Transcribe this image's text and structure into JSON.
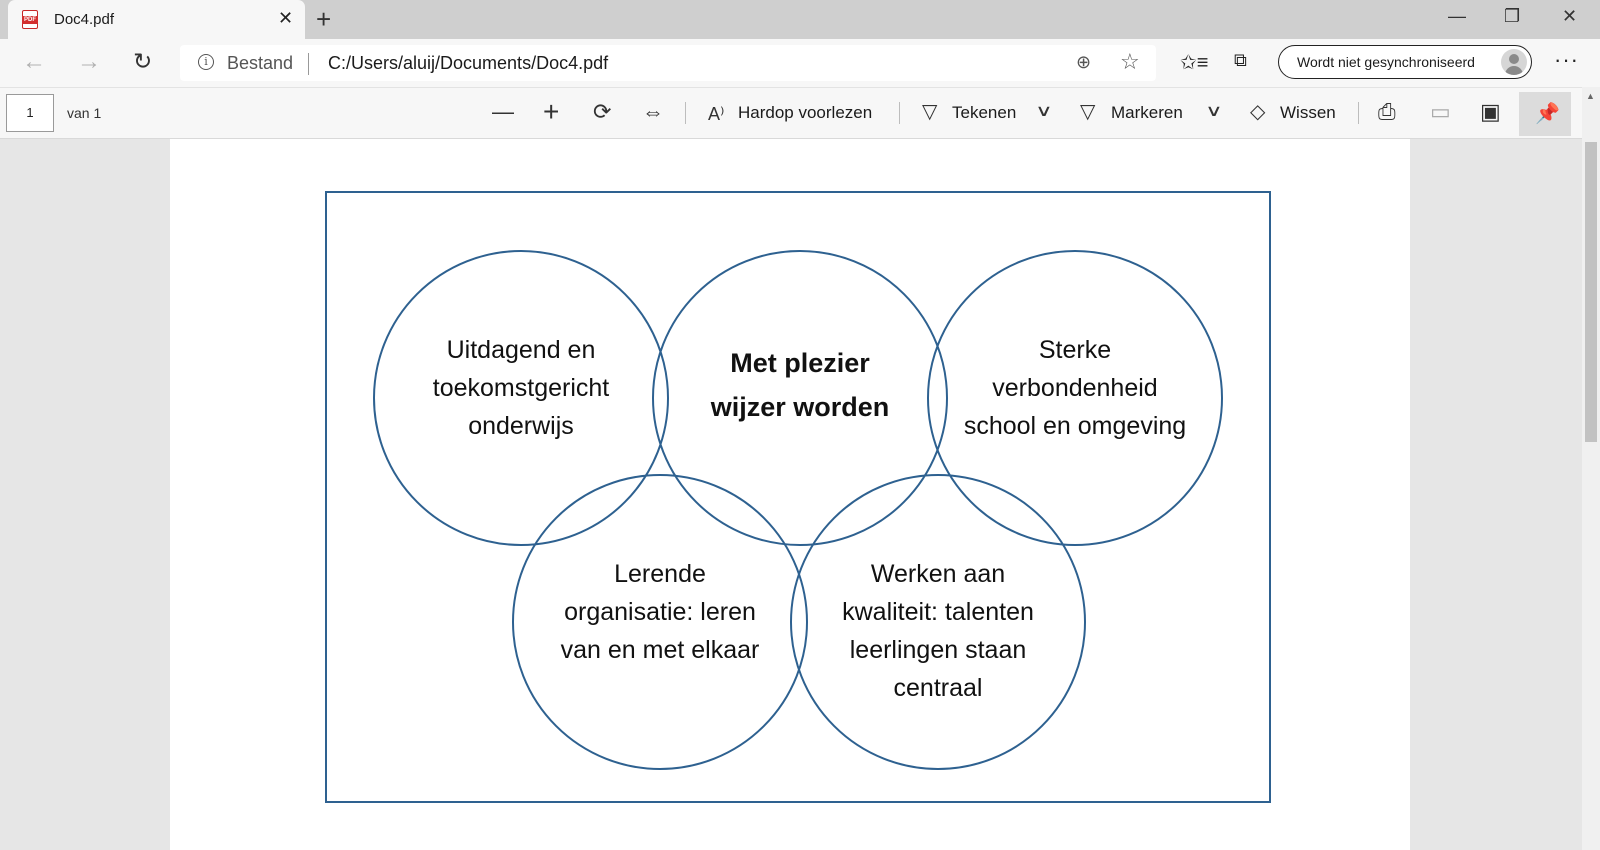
{
  "tab": {
    "title": "Doc4.pdf",
    "close": "✕",
    "new_tab": "+"
  },
  "window": {
    "minimize": "—",
    "restore": "❐",
    "close": "✕"
  },
  "nav": {
    "back": "←",
    "forward": "→",
    "refresh": "↻",
    "info": "i",
    "scheme": "Bestand",
    "url": "C:/Users/aluij/Documents/Doc4.pdf",
    "zoom": "⊕",
    "star": "☆",
    "favorites": "✩≡",
    "collections": "⧉",
    "sync_label": "Wordt niet gesynchroniseerd",
    "more": "···"
  },
  "pdf_toolbar": {
    "page_number": "1",
    "page_of": "van 1",
    "zoom_out": "—",
    "zoom_in": "+",
    "rotate": "⟳",
    "fit": "⇔",
    "read_aloud": "Hardop voorlezen",
    "read_icon": "A⁾",
    "draw": "Tekenen",
    "draw_icon": "▽",
    "highlight": "Markeren",
    "highlight_icon": "▽",
    "erase": "Wissen",
    "erase_icon": "◇",
    "chevron": "∨",
    "print": "⎙",
    "save": "▭",
    "save_as": "▣",
    "pin": "📌"
  },
  "diagram": {
    "stroke_color": "#2e6190",
    "circles": [
      {
        "lines": [
          "Uitdagend en",
          "toekomstgericht",
          "onderwijs"
        ],
        "bold": false
      },
      {
        "lines": [
          "Met plezier",
          "wijzer worden"
        ],
        "bold": true
      },
      {
        "lines": [
          "Sterke",
          "verbondenheid",
          "school en omgeving"
        ],
        "bold": false
      },
      {
        "lines": [
          "Lerende",
          "organisatie: leren",
          "van en met elkaar"
        ],
        "bold": false
      },
      {
        "lines": [
          "Werken aan",
          "kwaliteit: talenten",
          "leerlingen staan",
          "centraal"
        ],
        "bold": false
      }
    ]
  }
}
